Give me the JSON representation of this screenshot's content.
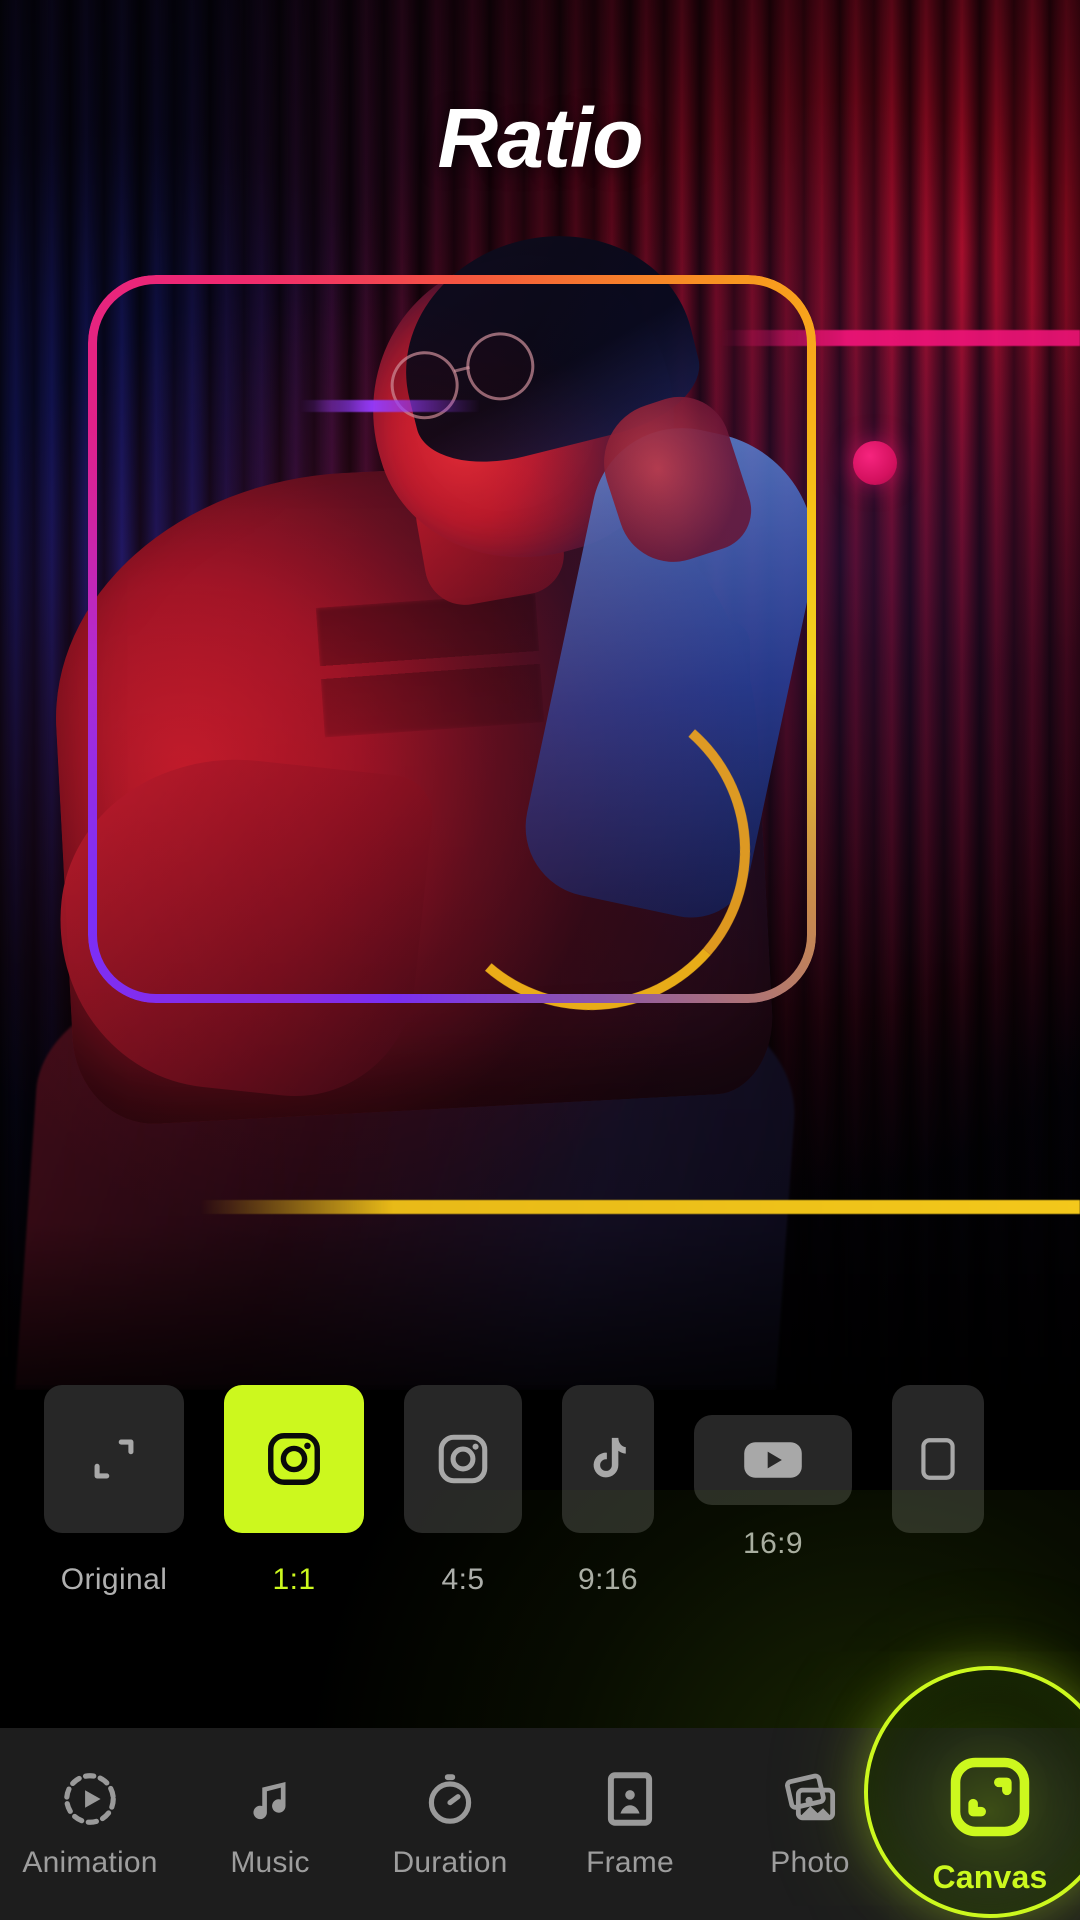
{
  "screen": {
    "title": "Ratio",
    "accent_color": "#ccf81e",
    "tile_color": "#272727",
    "nav_bg_color": "#1d1d1d",
    "label_color": "#b0b0b0"
  },
  "preview": {
    "frame_ratio": "1:1",
    "frame_gradient": [
      "#8a2be2",
      "#e0218a",
      "#f55a3c",
      "#f6c316"
    ]
  },
  "ratio_strip": {
    "items": [
      {
        "label": "Original",
        "icon": "expand-corners-icon",
        "selected": false
      },
      {
        "label": "1:1",
        "icon": "instagram-icon",
        "selected": true
      },
      {
        "label": "4:5",
        "icon": "instagram-icon",
        "selected": false
      },
      {
        "label": "9:16",
        "icon": "tiktok-icon",
        "selected": false
      },
      {
        "label": "16:9",
        "icon": "youtube-icon",
        "selected": false
      },
      {
        "label": "",
        "icon": "more-ratio-icon",
        "selected": false
      }
    ]
  },
  "bottom_nav": {
    "items": [
      {
        "label": "Animation",
        "icon": "animation-play-icon",
        "active": false
      },
      {
        "label": "Music",
        "icon": "music-note-icon",
        "active": false
      },
      {
        "label": "Duration",
        "icon": "stopwatch-icon",
        "active": false
      },
      {
        "label": "Frame",
        "icon": "portrait-frame-icon",
        "active": false
      },
      {
        "label": "Photo",
        "icon": "photos-stack-icon",
        "active": false
      },
      {
        "label": "Canvas",
        "icon": "canvas-resize-icon",
        "active": true
      }
    ]
  }
}
